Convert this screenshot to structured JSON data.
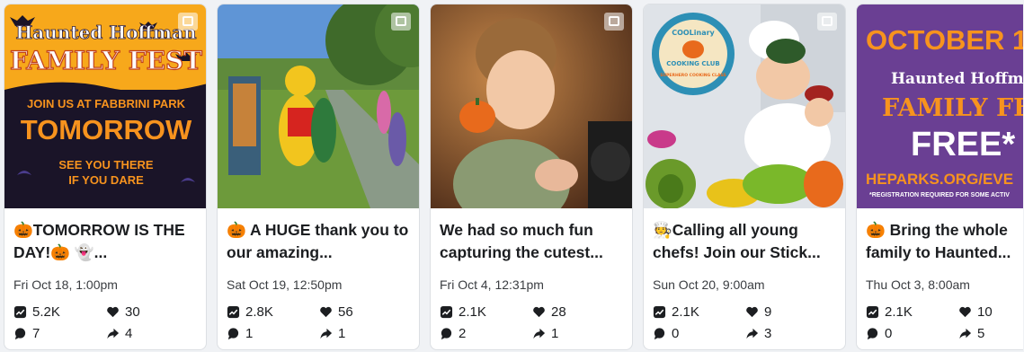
{
  "posts": [
    {
      "title": "🎃TOMORROW IS THE DAY!🎃 👻...",
      "date": "Fri Oct 18, 1:00pm",
      "reach": "5.2K",
      "likes": "30",
      "comments": "7",
      "shares": "4",
      "image": {
        "line1": "Haunted Hoffman",
        "line2": "FAMILY FEST",
        "line3": "JOIN US AT FABBRINI PARK",
        "line4": "TOMORROW",
        "line5": "SEE YOU THERE",
        "line6": "IF YOU DARE"
      }
    },
    {
      "title": "🎃 A HUGE thank you to our amazing...",
      "date": "Sat Oct 19, 12:50pm",
      "reach": "2.8K",
      "likes": "56",
      "comments": "1",
      "shares": "1"
    },
    {
      "title": "We had so much fun capturing the cutest...",
      "date": "Fri Oct 4, 12:31pm",
      "reach": "2.1K",
      "likes": "28",
      "comments": "2",
      "shares": "1"
    },
    {
      "title": "🧑‍🍳Calling all young chefs! Join our Stick...",
      "date": "Sun Oct 20, 9:00am",
      "reach": "2.1K",
      "likes": "9",
      "comments": "0",
      "shares": "3",
      "image": {
        "badge_top": "COOLinary",
        "badge_mid": "COOKING CLUB",
        "badge_bot": "SUPERHERO COOKING CLASS"
      }
    },
    {
      "title": "🎃 Bring the whole family to Haunted...",
      "date": "Thu Oct 3, 8:00am",
      "reach": "2.1K",
      "likes": "10",
      "comments": "0",
      "shares": "5",
      "image": {
        "line1": "OCTOBER 1",
        "line2": "Haunted Hoffman",
        "line3": "FAMILY FEST",
        "line4": "FREE*",
        "line5": "HEPARKS.ORG/EVE",
        "line6": "*REGISTRATION REQUIRED FOR SOME ACTIV"
      }
    }
  ],
  "colors": {
    "orange": "#f7931e",
    "purple": "#5b3a8c",
    "green_stat_bg": "#ffffff",
    "text": "#1c1e21"
  },
  "icons": {
    "reach": "trend-up-icon",
    "likes": "heart-icon",
    "comments": "comment-icon",
    "shares": "share-arrow-icon",
    "photo": "photo-icon"
  }
}
